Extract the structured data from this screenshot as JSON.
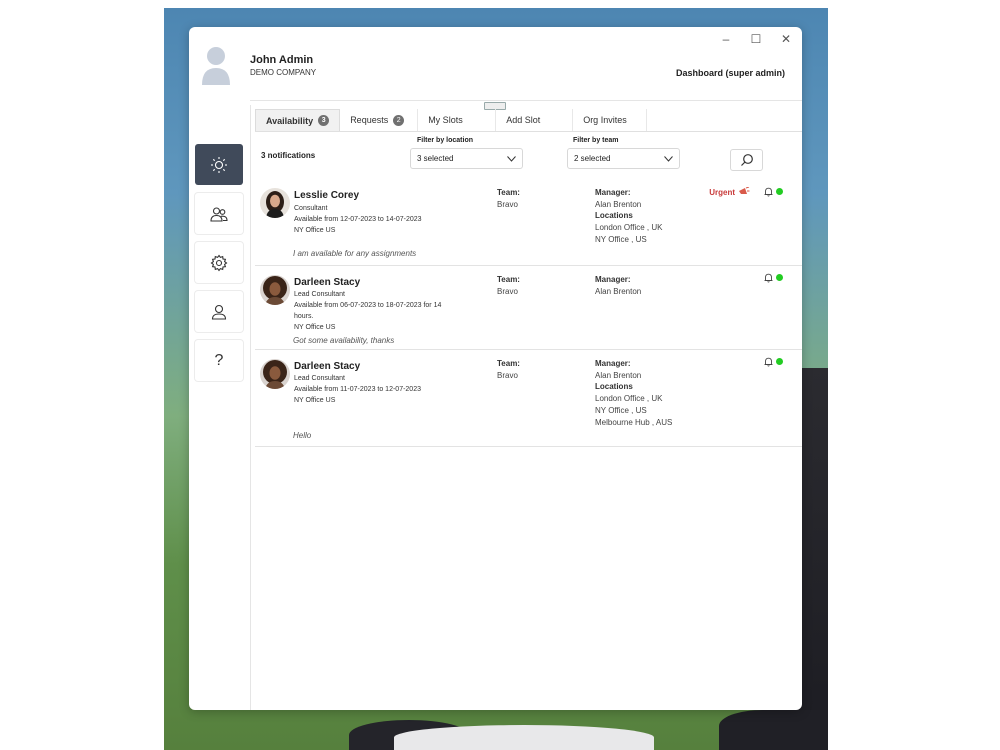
{
  "user": {
    "name": "John Admin",
    "company": "DEMO COMPANY",
    "role": "Dashboard (super admin)"
  },
  "window_controls": {
    "minimize": "–",
    "maximize": "☐",
    "close": "✕"
  },
  "sidebar": [
    {
      "icon": "sun-icon",
      "active": true
    },
    {
      "icon": "users-icon",
      "active": false
    },
    {
      "icon": "gear-icon",
      "active": false
    },
    {
      "icon": "user-icon",
      "active": false
    },
    {
      "icon": "help-icon",
      "label": "?",
      "active": false
    }
  ],
  "tabs": [
    {
      "label": "Availability",
      "badge": "3",
      "active": true
    },
    {
      "label": "Requests",
      "badge": "2",
      "active": false
    },
    {
      "label": "My Slots",
      "active": false
    },
    {
      "label": "Add Slot",
      "active": false
    },
    {
      "label": "Org Invites",
      "active": false
    }
  ],
  "notifications_count": "3 notifications",
  "filters": {
    "location": {
      "label": "Filter by location",
      "value": "3 selected"
    },
    "team": {
      "label": "Filter by team",
      "value": "2 selected"
    }
  },
  "labels": {
    "team": "Team:",
    "manager": "Manager:",
    "locations": "Locations",
    "urgent": "Urgent"
  },
  "notifications": [
    {
      "name": "Lesslie Corey",
      "title": "Consultant",
      "availability": "Available from 12-07-2023 to 14-07-2023",
      "office": "NY Office US",
      "note": "I am available for any assignments",
      "team": "Bravo",
      "manager": "Alan Brenton",
      "locations": [
        "London Office , UK",
        "NY Office , US"
      ],
      "urgent": true,
      "status_color": "#22cc22"
    },
    {
      "name": "Darleen Stacy",
      "title": "Lead Consultant",
      "availability_line1": "Available from 06-07-2023 to 18-07-2023 for 14",
      "availability_line2": "hours.",
      "office": "NY Office US",
      "note": "Got some availability, thanks",
      "team": "Bravo",
      "manager": "Alan Brenton",
      "urgent": false,
      "status_color": "#22cc22"
    },
    {
      "name": "Darleen Stacy",
      "title": "Lead Consultant",
      "availability": "Available from 11-07-2023 to 12-07-2023",
      "office": "NY Office US",
      "note": "Hello",
      "team": "Bravo",
      "manager": "Alan Brenton",
      "locations": [
        "London Office , UK",
        "NY Office , US",
        "Melbourne Hub , AUS"
      ],
      "urgent": false,
      "status_color": "#22cc22"
    }
  ]
}
